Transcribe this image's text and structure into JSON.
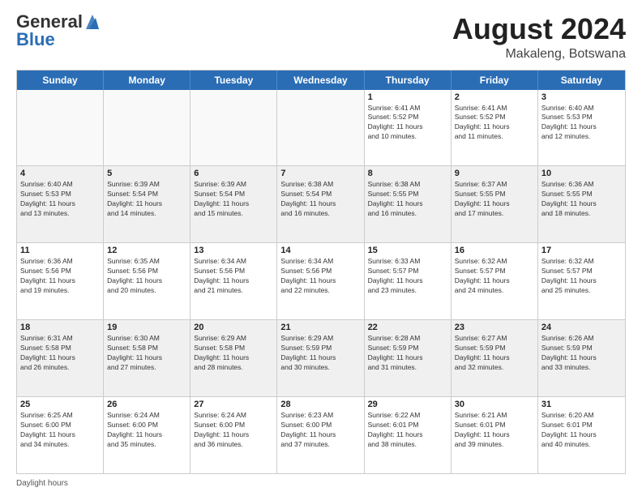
{
  "header": {
    "logo_general": "General",
    "logo_blue": "Blue",
    "month_title": "August 2024",
    "location": "Makaleng, Botswana"
  },
  "days_of_week": [
    "Sunday",
    "Monday",
    "Tuesday",
    "Wednesday",
    "Thursday",
    "Friday",
    "Saturday"
  ],
  "footer_text": "Daylight hours",
  "weeks": [
    [
      {
        "num": "",
        "info": "",
        "empty": true
      },
      {
        "num": "",
        "info": "",
        "empty": true
      },
      {
        "num": "",
        "info": "",
        "empty": true
      },
      {
        "num": "",
        "info": "",
        "empty": true
      },
      {
        "num": "1",
        "info": "Sunrise: 6:41 AM\nSunset: 5:52 PM\nDaylight: 11 hours\nand 10 minutes."
      },
      {
        "num": "2",
        "info": "Sunrise: 6:41 AM\nSunset: 5:52 PM\nDaylight: 11 hours\nand 11 minutes."
      },
      {
        "num": "3",
        "info": "Sunrise: 6:40 AM\nSunset: 5:53 PM\nDaylight: 11 hours\nand 12 minutes."
      }
    ],
    [
      {
        "num": "4",
        "info": "Sunrise: 6:40 AM\nSunset: 5:53 PM\nDaylight: 11 hours\nand 13 minutes."
      },
      {
        "num": "5",
        "info": "Sunrise: 6:39 AM\nSunset: 5:54 PM\nDaylight: 11 hours\nand 14 minutes."
      },
      {
        "num": "6",
        "info": "Sunrise: 6:39 AM\nSunset: 5:54 PM\nDaylight: 11 hours\nand 15 minutes."
      },
      {
        "num": "7",
        "info": "Sunrise: 6:38 AM\nSunset: 5:54 PM\nDaylight: 11 hours\nand 16 minutes."
      },
      {
        "num": "8",
        "info": "Sunrise: 6:38 AM\nSunset: 5:55 PM\nDaylight: 11 hours\nand 16 minutes."
      },
      {
        "num": "9",
        "info": "Sunrise: 6:37 AM\nSunset: 5:55 PM\nDaylight: 11 hours\nand 17 minutes."
      },
      {
        "num": "10",
        "info": "Sunrise: 6:36 AM\nSunset: 5:55 PM\nDaylight: 11 hours\nand 18 minutes."
      }
    ],
    [
      {
        "num": "11",
        "info": "Sunrise: 6:36 AM\nSunset: 5:56 PM\nDaylight: 11 hours\nand 19 minutes."
      },
      {
        "num": "12",
        "info": "Sunrise: 6:35 AM\nSunset: 5:56 PM\nDaylight: 11 hours\nand 20 minutes."
      },
      {
        "num": "13",
        "info": "Sunrise: 6:34 AM\nSunset: 5:56 PM\nDaylight: 11 hours\nand 21 minutes."
      },
      {
        "num": "14",
        "info": "Sunrise: 6:34 AM\nSunset: 5:56 PM\nDaylight: 11 hours\nand 22 minutes."
      },
      {
        "num": "15",
        "info": "Sunrise: 6:33 AM\nSunset: 5:57 PM\nDaylight: 11 hours\nand 23 minutes."
      },
      {
        "num": "16",
        "info": "Sunrise: 6:32 AM\nSunset: 5:57 PM\nDaylight: 11 hours\nand 24 minutes."
      },
      {
        "num": "17",
        "info": "Sunrise: 6:32 AM\nSunset: 5:57 PM\nDaylight: 11 hours\nand 25 minutes."
      }
    ],
    [
      {
        "num": "18",
        "info": "Sunrise: 6:31 AM\nSunset: 5:58 PM\nDaylight: 11 hours\nand 26 minutes."
      },
      {
        "num": "19",
        "info": "Sunrise: 6:30 AM\nSunset: 5:58 PM\nDaylight: 11 hours\nand 27 minutes."
      },
      {
        "num": "20",
        "info": "Sunrise: 6:29 AM\nSunset: 5:58 PM\nDaylight: 11 hours\nand 28 minutes."
      },
      {
        "num": "21",
        "info": "Sunrise: 6:29 AM\nSunset: 5:59 PM\nDaylight: 11 hours\nand 30 minutes."
      },
      {
        "num": "22",
        "info": "Sunrise: 6:28 AM\nSunset: 5:59 PM\nDaylight: 11 hours\nand 31 minutes."
      },
      {
        "num": "23",
        "info": "Sunrise: 6:27 AM\nSunset: 5:59 PM\nDaylight: 11 hours\nand 32 minutes."
      },
      {
        "num": "24",
        "info": "Sunrise: 6:26 AM\nSunset: 5:59 PM\nDaylight: 11 hours\nand 33 minutes."
      }
    ],
    [
      {
        "num": "25",
        "info": "Sunrise: 6:25 AM\nSunset: 6:00 PM\nDaylight: 11 hours\nand 34 minutes."
      },
      {
        "num": "26",
        "info": "Sunrise: 6:24 AM\nSunset: 6:00 PM\nDaylight: 11 hours\nand 35 minutes."
      },
      {
        "num": "27",
        "info": "Sunrise: 6:24 AM\nSunset: 6:00 PM\nDaylight: 11 hours\nand 36 minutes."
      },
      {
        "num": "28",
        "info": "Sunrise: 6:23 AM\nSunset: 6:00 PM\nDaylight: 11 hours\nand 37 minutes."
      },
      {
        "num": "29",
        "info": "Sunrise: 6:22 AM\nSunset: 6:01 PM\nDaylight: 11 hours\nand 38 minutes."
      },
      {
        "num": "30",
        "info": "Sunrise: 6:21 AM\nSunset: 6:01 PM\nDaylight: 11 hours\nand 39 minutes."
      },
      {
        "num": "31",
        "info": "Sunrise: 6:20 AM\nSunset: 6:01 PM\nDaylight: 11 hours\nand 40 minutes."
      }
    ]
  ]
}
